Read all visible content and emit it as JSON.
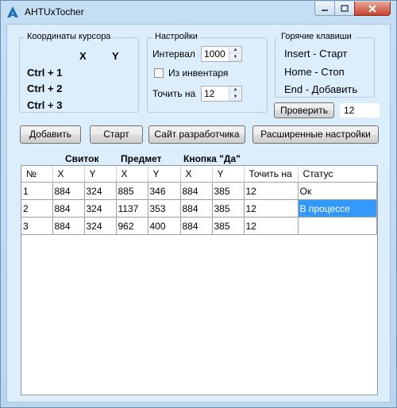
{
  "window": {
    "title": "AHTUxTocher"
  },
  "cursor_group": {
    "legend": "Координаты курсора",
    "x_label": "X",
    "y_label": "Y",
    "hotkeys": [
      "Ctrl + 1",
      "Ctrl + 2",
      "Ctrl + 3"
    ]
  },
  "settings_group": {
    "legend": "Настройки",
    "interval_label": "Интервал",
    "interval_value": "1000",
    "inventory_label": "Из инвентаря",
    "inventory_checked": false,
    "sharpen_label": "Точить на",
    "sharpen_value": "12"
  },
  "hotkeys_group": {
    "legend": "Горячие клавиши",
    "items": [
      "Insert - Старт",
      "Home - Стоп",
      "End - Добавить"
    ]
  },
  "check_button": "Проверить",
  "check_value": "12",
  "buttons": {
    "add": "Добавить",
    "start": "Старт",
    "dev_site": "Сайт разработчика",
    "advanced": "Расширенные настройки"
  },
  "group_headers": {
    "scroll": "Свиток",
    "item": "Предмет",
    "yes_button": "Кнопка \"Да\""
  },
  "table": {
    "columns": [
      "№",
      "X",
      "Y",
      "X",
      "Y",
      "X",
      "Y",
      "Точить на",
      "Статус"
    ],
    "rows": [
      [
        "1",
        "884",
        "324",
        "885",
        "346",
        "884",
        "385",
        "12",
        "Ок"
      ],
      [
        "2",
        "884",
        "324",
        "1137",
        "353",
        "884",
        "385",
        "12",
        "В процессе"
      ],
      [
        "3",
        "884",
        "324",
        "962",
        "400",
        "884",
        "385",
        "12",
        ""
      ]
    ],
    "selected_cell": {
      "row": 1,
      "col": 8
    }
  },
  "colors": {
    "selection": "#3399ff",
    "close_button": "#c7432b",
    "background": "#dceefc"
  }
}
